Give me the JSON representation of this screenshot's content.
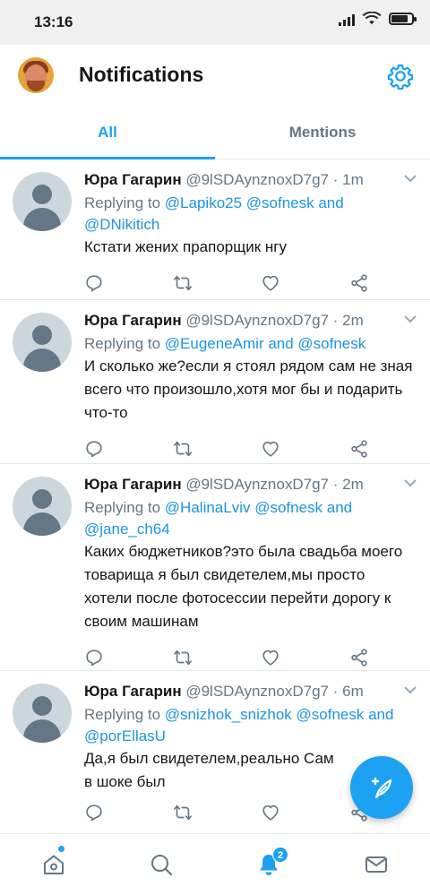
{
  "status_bar": {
    "time": "13:16"
  },
  "header": {
    "title": "Notifications"
  },
  "tabs": [
    {
      "label": "All",
      "active": true
    },
    {
      "label": "Mentions",
      "active": false
    }
  ],
  "tweets": [
    {
      "name": "Юра Гагарин",
      "handle": "@9lSDAynznoxD7g7",
      "separator": "·",
      "time": "1m",
      "replying_label": "Replying to",
      "replying_to": "@Lapiko25 @sofnesk and @DNikitich",
      "text": "Кстати жених прапорщик нгу"
    },
    {
      "name": "Юра Гагарин",
      "handle": "@9lSDAynznoxD7g7",
      "separator": "·",
      "time": "2m",
      "replying_label": "Replying to",
      "replying_to": "@EugeneAmir and @sofnesk",
      "text": "И сколько же?если я стоял рядом сам не зная всего что произошло,хотя мог бы и подарить что-то"
    },
    {
      "name": "Юра Гагарин",
      "handle": "@9lSDAynznoxD7g7",
      "separator": "·",
      "time": "2m",
      "replying_label": "Replying to",
      "replying_to": "@HalinaLviv @sofnesk and @jane_ch64",
      "text": "Каких бюджетников?это была свадьба моего товарища я был свидетелем,мы просто хотели после фотосессии перейти дорогу к своим машинам"
    },
    {
      "name": "Юра Гагарин",
      "handle": "@9lSDAynznoxD7g7",
      "separator": "·",
      "time": "6m",
      "replying_label": "Replying to",
      "replying_to": "@snizhok_snizhok @sofnesk and @porEllasU",
      "text": "Да,я был свидетелем,реально Сам в шоке был"
    }
  ],
  "bottom_nav": {
    "items": [
      {
        "name": "home-icon",
        "active": false
      },
      {
        "name": "search-icon",
        "active": false
      },
      {
        "name": "notifications-icon",
        "active": true,
        "badge": "2"
      },
      {
        "name": "messages-icon",
        "active": false
      }
    ]
  },
  "colors": {
    "accent": "#1da1f2",
    "mention": "#1b95e0",
    "muted": "#657786",
    "text": "#14171a"
  }
}
